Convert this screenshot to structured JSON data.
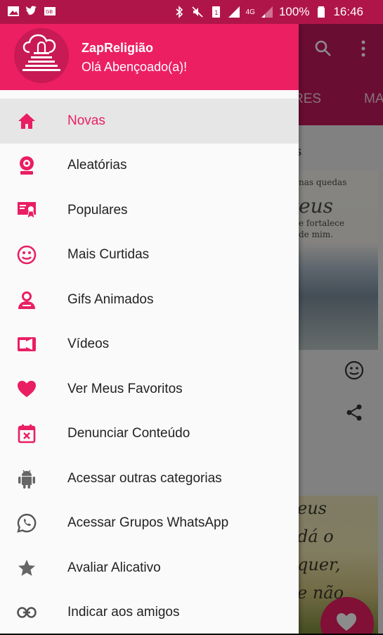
{
  "status_bar": {
    "battery": "100%",
    "time": "16:46",
    "network": "4G"
  },
  "background_app": {
    "tabs": [
      "RES",
      "MA"
    ],
    "section_title": "s",
    "image1_text": [
      "nas quedas",
      "eus",
      "e fortalece",
      "de mim."
    ],
    "image2_text": [
      "eus",
      "dá o",
      "quer,",
      "e não"
    ]
  },
  "drawer": {
    "app_name": "ZapReligião",
    "greeting": "Olá Abençoado(a)!",
    "accent_color": "#e91e63",
    "items": [
      {
        "label": "Novas",
        "icon": "home-icon",
        "active": true
      },
      {
        "label": "Aleatórias",
        "icon": "webcam-icon",
        "active": false
      },
      {
        "label": "Populares",
        "icon": "certificate-icon",
        "active": false
      },
      {
        "label": "Mais Curtidas",
        "icon": "smiley-icon",
        "active": false
      },
      {
        "label": "Gifs Animados",
        "icon": "person-icon",
        "active": false
      },
      {
        "label": "Vídeos",
        "icon": "video-icon",
        "active": false
      },
      {
        "label": "Ver Meus Favoritos",
        "icon": "heart-icon",
        "active": false
      },
      {
        "label": "Denunciar Conteúdo",
        "icon": "calendar-x-icon",
        "active": false
      },
      {
        "label": "Acessar outras categorias",
        "icon": "android-icon",
        "active": false
      },
      {
        "label": "Acessar Grupos WhatsApp",
        "icon": "whatsapp-icon",
        "active": false
      },
      {
        "label": "Avaliar Alicativo",
        "icon": "star-icon",
        "active": false
      },
      {
        "label": "Indicar aos amigos",
        "icon": "link-icon",
        "active": false
      }
    ]
  }
}
